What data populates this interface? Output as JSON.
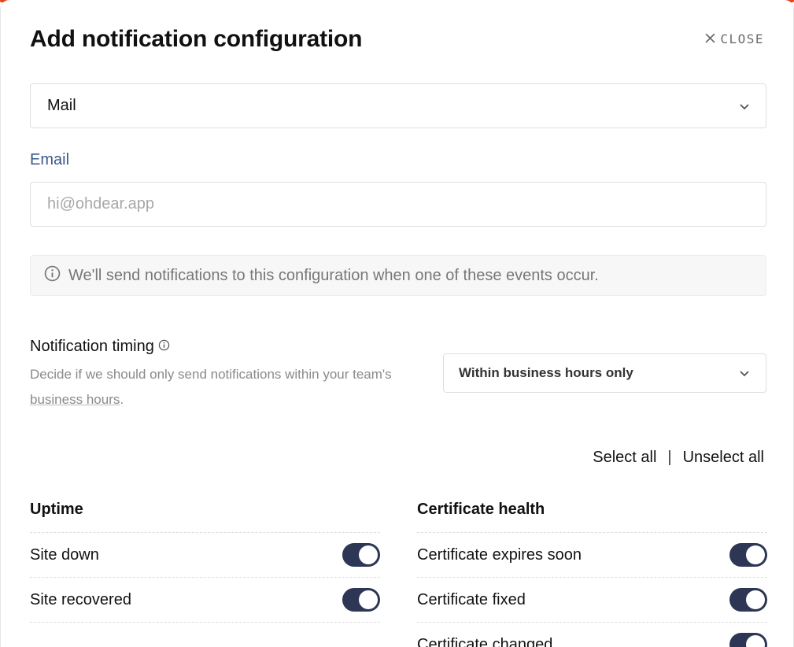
{
  "modal": {
    "title": "Add notification configuration",
    "close_label": "CLOSE"
  },
  "channel": {
    "selected": "Mail"
  },
  "email": {
    "label": "Email",
    "value": "",
    "placeholder": "hi@ohdear.app"
  },
  "info": {
    "text": "We'll send notifications to this configuration when one of these events occur."
  },
  "timing": {
    "title": "Notification timing",
    "description_prefix": "Decide if we should only send notifications within your team's",
    "description_link": "business hours",
    "description_suffix": ".",
    "selected": "Within business hours only"
  },
  "bulk": {
    "select_all": "Select all",
    "separator": "|",
    "unselect_all": "Unselect all"
  },
  "groups": {
    "uptime": {
      "title": "Uptime",
      "items": [
        {
          "label": "Site down",
          "enabled": true
        },
        {
          "label": "Site recovered",
          "enabled": true
        }
      ]
    },
    "certificate": {
      "title": "Certificate health",
      "items": [
        {
          "label": "Certificate expires soon",
          "enabled": true
        },
        {
          "label": "Certificate fixed",
          "enabled": true
        },
        {
          "label": "Certificate changed",
          "enabled": true
        }
      ]
    }
  },
  "colors": {
    "accent": "#e8431a",
    "toggle_on": "#2d3655",
    "label_blue": "#3a5a8c"
  }
}
